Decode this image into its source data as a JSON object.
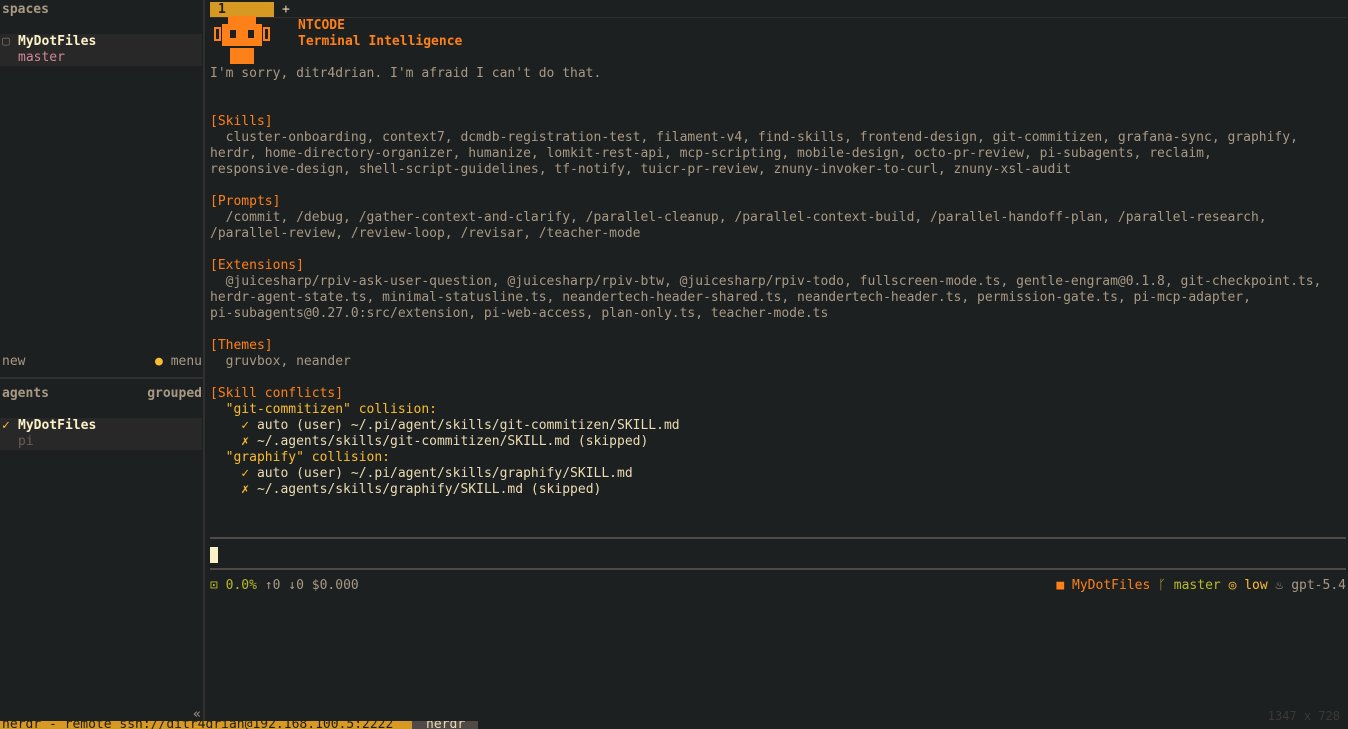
{
  "sidebar": {
    "spaces_header": "spaces",
    "space_item": {
      "marker": "▢",
      "name": "MyDotFiles",
      "branch": "master"
    },
    "new_label": "new",
    "menu_dot": "●",
    "menu_label": "menu",
    "agents_header": "agents",
    "grouped_label": "grouped",
    "agent_item": {
      "check": "✓",
      "name": "MyDotFiles",
      "sub": "pi"
    },
    "collapse": "«"
  },
  "tabs": {
    "active": "1",
    "add": "+"
  },
  "brand": {
    "title": "NTCODE",
    "subtitle": "Terminal Intelligence"
  },
  "greeting": "I'm sorry, ditr4drian. I'm afraid I can't do that.",
  "sections": {
    "skills_header": "[Skills]",
    "skills_lines": [
      "  cluster-onboarding, context7, dcmdb-registration-test, filament-v4, find-skills, frontend-design, git-commitizen, grafana-sync, graphify,",
      "herdr, home-directory-organizer, humanize, lomkit-rest-api, mcp-scripting, mobile-design, octo-pr-review, pi-subagents, reclaim,",
      "responsive-design, shell-script-guidelines, tf-notify, tuicr-pr-review, znuny-invoker-to-curl, znuny-xsl-audit"
    ],
    "prompts_header": "[Prompts]",
    "prompts_lines": [
      "  /commit, /debug, /gather-context-and-clarify, /parallel-cleanup, /parallel-context-build, /parallel-handoff-plan, /parallel-research,",
      "/parallel-review, /review-loop, /revisar, /teacher-mode"
    ],
    "extensions_header": "[Extensions]",
    "extensions_lines": [
      "  @juicesharp/rpiv-ask-user-question, @juicesharp/rpiv-btw, @juicesharp/rpiv-todo, fullscreen-mode.ts, gentle-engram@0.1.8, git-checkpoint.ts,",
      "herdr-agent-state.ts, minimal-statusline.ts, neandertech-header-shared.ts, neandertech-header.ts, permission-gate.ts, pi-mcp-adapter,",
      "pi-subagents@0.27.0:src/extension, pi-web-access, plan-only.ts, teacher-mode.ts"
    ],
    "themes_header": "[Themes]",
    "themes_line": "  gruvbox, neander",
    "conflicts_header": "[Skill conflicts]",
    "conflict1_title": "  \"git-commitizen\" collision:",
    "conflict1_ok_mark": "    ✓ ",
    "conflict1_ok": "auto (user) ~/.pi/agent/skills/git-commitizen/SKILL.md",
    "conflict1_skip_mark": "    ✗ ",
    "conflict1_skip": "~/.agents/skills/git-commitizen/SKILL.md (skipped)",
    "conflict2_title": "  \"graphify\" collision:",
    "conflict2_ok_mark": "    ✓ ",
    "conflict2_ok": "auto (user) ~/.pi/agent/skills/graphify/SKILL.md",
    "conflict2_skip_mark": "    ✗ ",
    "conflict2_skip": "~/.agents/skills/graphify/SKILL.md (skipped)"
  },
  "status": {
    "ctx_icon": "⊡",
    "ctx_pct": "0.0%",
    "tokens": "↑0 ↓0",
    "cost": "$0.000",
    "folder_icon": "■",
    "project": "MyDotFiles",
    "branch_icon": "ᚴ",
    "branch": "master",
    "effort_icon": "◎",
    "effort": "low",
    "model_icon": "♨",
    "model": "gpt-5.4"
  },
  "bottom": {
    "session": "herdr - remote ssh://ditr4drian@192.168.100.5:2222",
    "tab": "herdr"
  },
  "dims": "1347 x 728"
}
